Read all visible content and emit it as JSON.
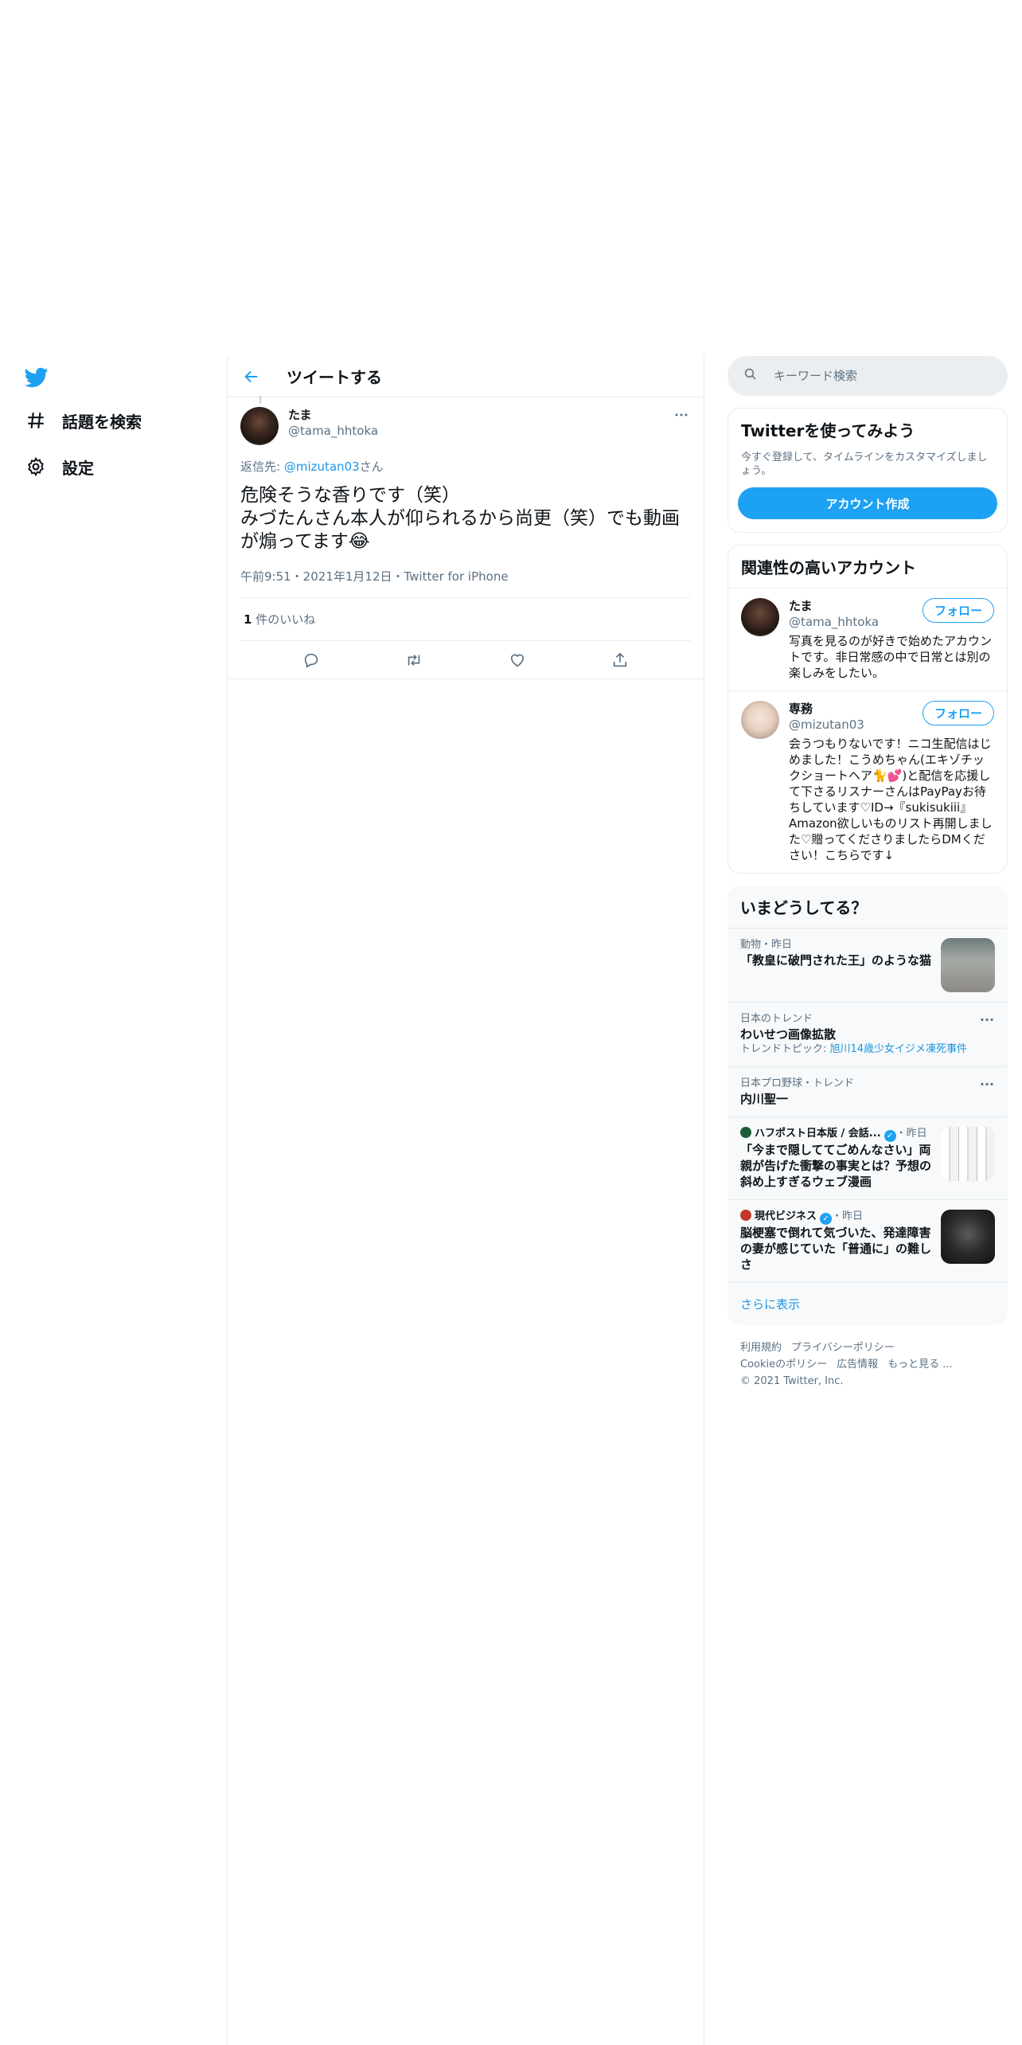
{
  "nav": {
    "items": [
      {
        "label": "話題を検索",
        "icon": "hashtag-icon"
      },
      {
        "label": "設定",
        "icon": "gear-icon"
      }
    ]
  },
  "header": {
    "title": "ツイートする"
  },
  "tweet": {
    "name": "たま",
    "handle": "@tama_hhtoka",
    "reply_prefix": "返信先: ",
    "reply_mention": "@mizutan03",
    "reply_suffix": "さん",
    "text": "危険そうな香りです（笑）\nみづたんさん本人が仰られるから尚更（笑）でも動画が煽ってます😂",
    "meta": "午前9:51・2021年1月12日・Twitter for iPhone",
    "likes_count": "1",
    "likes_label": " 件のいいね"
  },
  "search": {
    "placeholder": "キーワード検索"
  },
  "signup": {
    "title": "Twitterを使ってみよう",
    "desc": "今すぐ登録して、タイムラインをカスタマイズしましょう。",
    "button": "アカウント作成"
  },
  "related": {
    "title": "関連性の高いアカウント",
    "accounts": [
      {
        "name": "たま",
        "handle": "@tama_hhtoka",
        "follow": "フォロー",
        "bio": "写真を見るのが好きで始めたアカウントです。非日常感の中で日常とは別の楽しみをしたい。"
      },
      {
        "name": "専務",
        "handle": "@mizutan03",
        "follow": "フォロー",
        "bio": "会うつもりないです！ニコ生配信はじめました！こうめちゃん(エキゾチックショートヘア🐈💕)と配信を応援して下さるリスナーさんはPayPayお待ちしています♡ID→『sukisukiii』Amazon欲しいものリスト再開しました♡贈ってくださりましたらDMください！こちらです↓"
      }
    ]
  },
  "trends": {
    "title": "いまどうしてる？",
    "items": [
      {
        "meta": "動物・昨日",
        "title": "「教皇に破門された王」のような猫",
        "sub": "",
        "sublink": ""
      },
      {
        "meta": "日本のトレンド",
        "title": "わいせつ画像拡散",
        "sub": "トレンドトピック: ",
        "sublink": "旭川14歳少女イジメ凍死事件"
      },
      {
        "meta": "日本プロ野球・トレンド",
        "title": "内川聖一",
        "sub": "",
        "sublink": ""
      },
      {
        "source": "ハフポスト日本版 / 会話...",
        "time": "・昨日",
        "title": "「今まで隠しててごめんなさい」両親が告げた衝撃の事実とは？予想の斜め上すぎるウェブ漫画"
      },
      {
        "source": "現代ビジネス",
        "time": "・昨日",
        "title": "脳梗塞で倒れて気づいた、発達障害の妻が感じていた「普通に」の難しさ"
      }
    ],
    "show_more": "さらに表示"
  },
  "footer": {
    "links": [
      "利用規約",
      "プライバシーポリシー",
      "Cookieのポリシー",
      "広告情報",
      "もっと見る ..."
    ],
    "copyright": "© 2021 Twitter, Inc."
  },
  "colors": {
    "accent": "#1da1f2",
    "link": "#1b95e0",
    "muted": "#5b7083"
  }
}
